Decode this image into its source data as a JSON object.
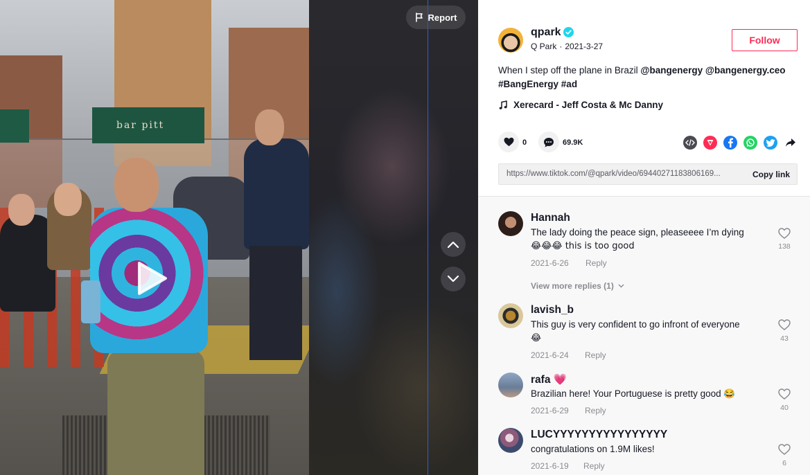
{
  "video": {
    "report_label": "Report",
    "storefront_sign": "bar pitt"
  },
  "author": {
    "username": "qpark",
    "display_name": "Q Park",
    "separator": "·",
    "date": "2021-3-27",
    "verified": true
  },
  "follow_label": "Follow",
  "caption": {
    "text": "When I step off the plane in Brazil",
    "tags": [
      "@bangenergy",
      "@bangenergy.ceo",
      "#BangEnergy",
      "#ad"
    ]
  },
  "music": {
    "title": "Xerecard - Jeff Costa & Mc Danny"
  },
  "stats": {
    "likes": "0",
    "comments": "69.9K"
  },
  "share_icons": [
    "embed-icon",
    "tiktok-share-icon",
    "facebook-icon",
    "whatsapp-icon",
    "twitter-icon",
    "share-arrow-icon"
  ],
  "link": {
    "url": "https://www.tiktok.com/@qpark/video/69440271183806169...",
    "copy_label": "Copy link"
  },
  "comments": [
    {
      "name": "Hannah",
      "line1": "The lady doing the peace sign, pleaseeee I’m dying",
      "line2": "😂😂😂 this is too good",
      "date": "2021-6-26",
      "reply_label": "Reply",
      "likes": "138",
      "view_replies": "View more replies (1)"
    },
    {
      "name": "lavish_b",
      "line1": "This guy is very confident to go infront of everyone",
      "line2": "😂",
      "date": "2021-6-24",
      "reply_label": "Reply",
      "likes": "43"
    },
    {
      "name": "rafa 💗",
      "line1": "Brazilian here! Your Portuguese is pretty good 😂",
      "date": "2021-6-29",
      "reply_label": "Reply",
      "likes": "40"
    },
    {
      "name": "LUCYYYYYYYYYYYYYYYY",
      "line1": "congratulations on 1.9M likes!",
      "date": "2021-6-19",
      "reply_label": "Reply",
      "likes": "6"
    }
  ],
  "colors": {
    "accent": "#fe2c55",
    "verified": "#20d5ec",
    "text": "#161823",
    "muted": "#8a8b91"
  }
}
